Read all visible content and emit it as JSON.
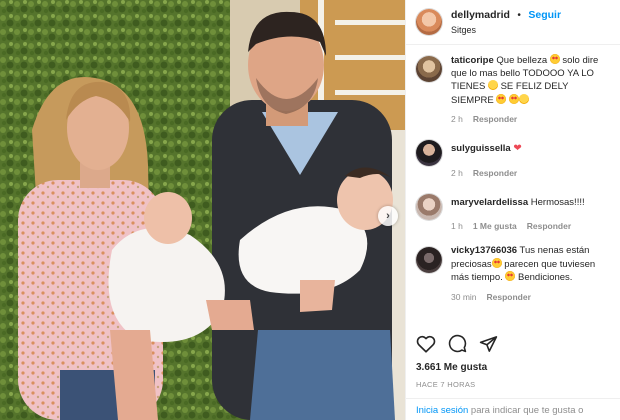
{
  "post": {
    "username": "dellymadrid",
    "dot": "•",
    "follow_label": "Seguir",
    "location": "Sitges",
    "avatar_icon": "profile-avatar"
  },
  "comments": [
    {
      "user": "taticoripe",
      "text_a": " Que belleza ",
      "text_b": " solo dire que lo mas bello TODOOO YA LO TIENES ",
      "text_c": " SE FELIZ DELY SIEMPRE ",
      "time": "2 h",
      "reply_label": "Responder"
    },
    {
      "user": "sulyguissella",
      "text_a": " ",
      "time": "2 h",
      "reply_label": "Responder"
    },
    {
      "user": "maryvelardelissa",
      "text_a": " Hermosas!!!!",
      "time": "1 h",
      "likes_label": "1 Me gusta",
      "reply_label": "Responder"
    },
    {
      "user": "vicky13766036",
      "text_a": " Tus nenas están preciosas",
      "text_b": " parecen que tuviesen más tiempo. ",
      "text_c": " Bendiciones.",
      "time": "30 min",
      "reply_label": "Responder"
    }
  ],
  "likes": "3.661 Me gusta",
  "timestamp": "HACE 7 HORAS",
  "login": {
    "link": "Inicia sesión",
    "rest": " para indicar que te gusta o"
  },
  "colors": {
    "accent": "#0095f6",
    "heart": "#ed4956",
    "muted": "#8e8e8e"
  }
}
